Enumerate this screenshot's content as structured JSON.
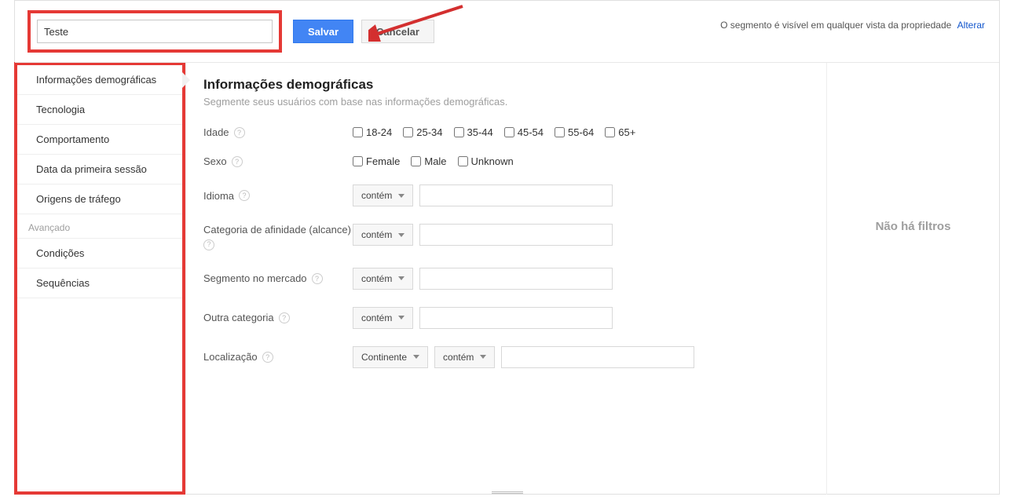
{
  "header": {
    "name_value": "Teste",
    "save_label": "Salvar",
    "cancel_label": "Cancelar",
    "visibility_text": "O segmento é visível em qualquer vista da propriedade",
    "change_link": "Alterar"
  },
  "sidebar": {
    "items": [
      {
        "label": "Informações demográficas",
        "active": true
      },
      {
        "label": "Tecnologia"
      },
      {
        "label": "Comportamento"
      },
      {
        "label": "Data da primeira sessão"
      },
      {
        "label": "Origens de tráfego"
      }
    ],
    "advanced_group": "Avançado",
    "advanced_items": [
      {
        "label": "Condições"
      },
      {
        "label": "Sequências"
      }
    ]
  },
  "main": {
    "title": "Informações demográficas",
    "subtitle": "Segmente seus usuários com base nas informações demográficas.",
    "labels": {
      "age": "Idade",
      "sex": "Sexo",
      "language": "Idioma",
      "affinity": "Categoria de afinidade (alcance)",
      "in_market": "Segmento no mercado",
      "other_category": "Outra categoria",
      "location": "Localização"
    },
    "age_options": [
      "18-24",
      "25-34",
      "35-44",
      "45-54",
      "55-64",
      "65+"
    ],
    "sex_options": [
      "Female",
      "Male",
      "Unknown"
    ],
    "operator_contains": "contém",
    "location_dim": "Continente"
  },
  "right": {
    "no_filters": "Não há filtros"
  }
}
